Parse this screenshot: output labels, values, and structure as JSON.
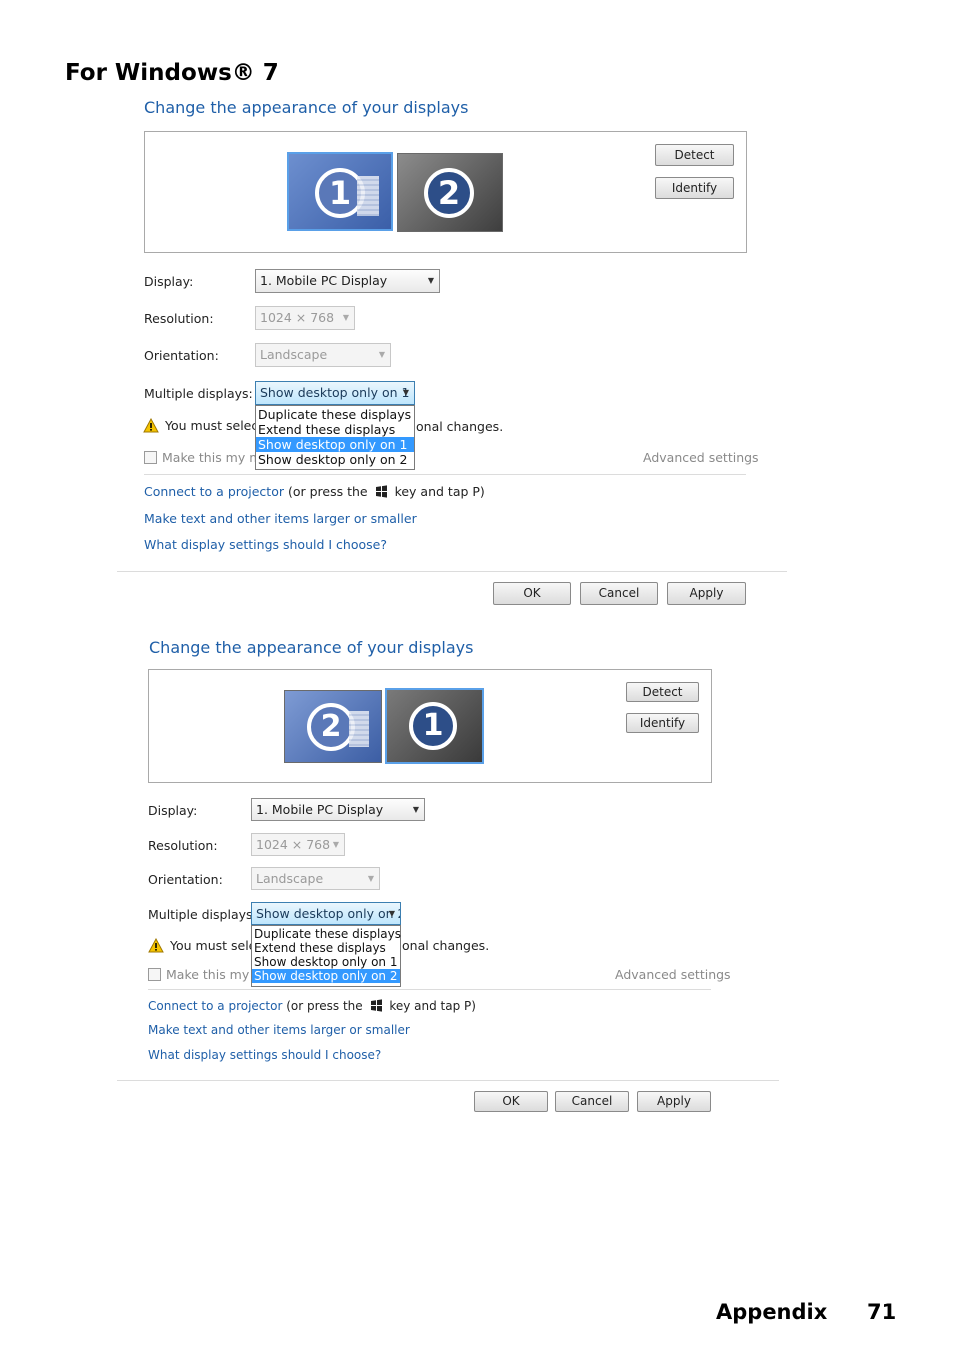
{
  "page_heading": "For Windows® 7",
  "panels": [
    {
      "title": "Change the appearance of your displays",
      "detect_label": "Detect",
      "identify_label": "Identify",
      "monitors": [
        "1",
        "2"
      ],
      "display_label": "Display:",
      "display_value": "1. Mobile PC Display",
      "resolution_label": "Resolution:",
      "resolution_value": "1024 × 768",
      "orientation_label": "Orientation:",
      "orientation_value": "Landscape",
      "multiple_label": "Multiple displays:",
      "multiple_value": "Show desktop only on 1",
      "dropdown_options": [
        "Duplicate these displays",
        "Extend these displays",
        "Show desktop only on 1",
        "Show desktop only on 2"
      ],
      "selected_index": 2,
      "warning_left": "You must select",
      "warning_right": "onal changes.",
      "checkbox_text": "Make this my ma",
      "advanced_settings": "Advanced settings",
      "projector_link": "Connect to a projector",
      "projector_text_pre": "(or press the",
      "projector_text_post": "key and tap P)",
      "text_size_link": "Make text and other items larger or smaller",
      "help_link": "What display settings should I choose?",
      "ok_label": "OK",
      "cancel_label": "Cancel",
      "apply_label": "Apply"
    },
    {
      "title": "Change the appearance of your displays",
      "detect_label": "Detect",
      "identify_label": "Identify",
      "monitors": [
        "2",
        "1"
      ],
      "display_label": "Display:",
      "display_value": "1. Mobile PC Display",
      "resolution_label": "Resolution:",
      "resolution_value": "1024 × 768",
      "orientation_label": "Orientation:",
      "orientation_value": "Landscape",
      "multiple_label": "Multiple displays:",
      "multiple_value": "Show desktop only on 2",
      "dropdown_options": [
        "Duplicate these displays",
        "Extend these displays",
        "Show desktop only on 1",
        "Show desktop only on 2"
      ],
      "selected_index": 3,
      "warning_left": "You must select",
      "warning_right": "onal changes.",
      "checkbox_text": "Make this my ma",
      "advanced_settings": "Advanced settings",
      "projector_link": "Connect to a projector",
      "projector_text_pre": "(or press the",
      "projector_text_post": "key and tap P)",
      "text_size_link": "Make text and other items larger or smaller",
      "help_link": "What display settings should I choose?",
      "ok_label": "OK",
      "cancel_label": "Cancel",
      "apply_label": "Apply"
    }
  ],
  "footer": {
    "section": "Appendix",
    "page_number": "71"
  }
}
